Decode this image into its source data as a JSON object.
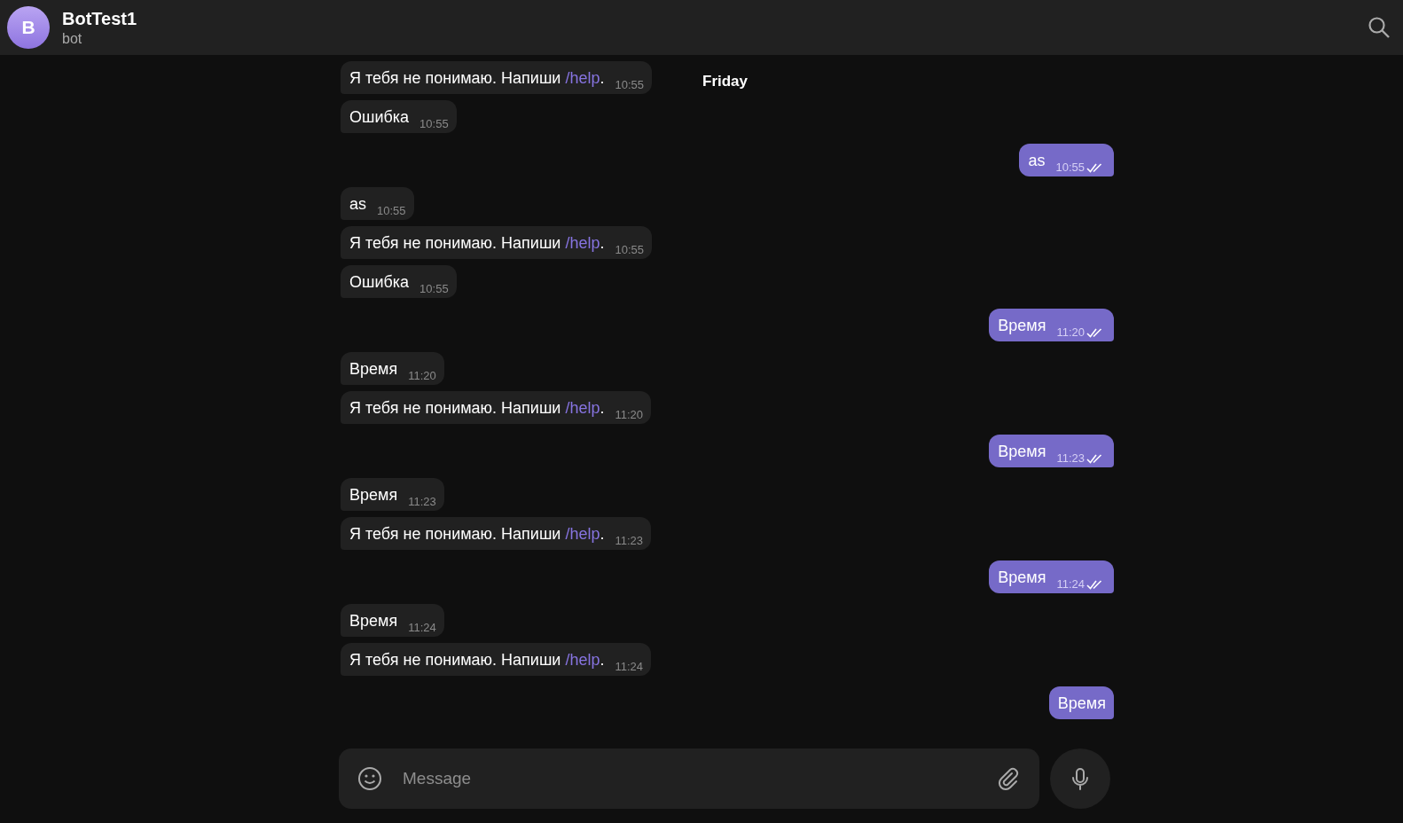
{
  "header": {
    "avatar_letter": "B",
    "title": "BotTest1",
    "subtitle": "bot"
  },
  "date_label": "Friday",
  "messages": [
    {
      "outgoing": false,
      "text": "Я тебя не понимаю. Напиши ",
      "link": "/help",
      "text_after": ".",
      "time": "10:55"
    },
    {
      "outgoing": false,
      "text": "Ошибка",
      "time": "10:55"
    },
    {
      "outgoing": true,
      "text": "as",
      "time": "10:55",
      "read": true
    },
    {
      "outgoing": false,
      "text": "as",
      "time": "10:55"
    },
    {
      "outgoing": false,
      "text": "Я тебя не понимаю. Напиши ",
      "link": "/help",
      "text_after": ".",
      "time": "10:55"
    },
    {
      "outgoing": false,
      "text": "Ошибка",
      "time": "10:55"
    },
    {
      "outgoing": true,
      "text": "Время",
      "time": "11:20",
      "read": true
    },
    {
      "outgoing": false,
      "text": "Время",
      "time": "11:20"
    },
    {
      "outgoing": false,
      "text": "Я тебя не понимаю. Напиши ",
      "link": "/help",
      "text_after": ".",
      "time": "11:20"
    },
    {
      "outgoing": true,
      "text": "Время",
      "time": "11:23",
      "read": true
    },
    {
      "outgoing": false,
      "text": "Время",
      "time": "11:23"
    },
    {
      "outgoing": false,
      "text": "Я тебя не понимаю. Напиши ",
      "link": "/help",
      "text_after": ".",
      "time": "11:23"
    },
    {
      "outgoing": true,
      "text": "Время",
      "time": "11:24",
      "read": true
    },
    {
      "outgoing": false,
      "text": "Время",
      "time": "11:24"
    },
    {
      "outgoing": false,
      "text": "Я тебя не понимаю. Напиши ",
      "link": "/help",
      "text_after": ".",
      "time": "11:24"
    },
    {
      "outgoing": true,
      "text": "Время"
    }
  ],
  "composer": {
    "placeholder": "Message"
  }
}
